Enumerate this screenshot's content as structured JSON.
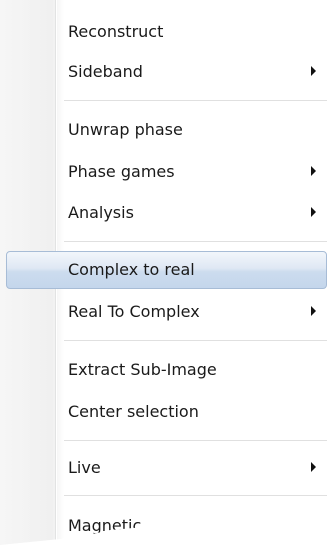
{
  "menu": {
    "items": [
      {
        "label": "Reconstruct",
        "submenu": false
      },
      {
        "label": "Sideband",
        "submenu": true
      },
      {
        "label": "Unwrap phase",
        "submenu": false
      },
      {
        "label": "Phase games",
        "submenu": true
      },
      {
        "label": "Analysis",
        "submenu": true
      },
      {
        "label": "Complex to real",
        "submenu": false,
        "highlighted": true
      },
      {
        "label": "Real To Complex",
        "submenu": true
      },
      {
        "label": "Extract Sub-Image",
        "submenu": false
      },
      {
        "label": "Center selection",
        "submenu": false
      },
      {
        "label": "Live",
        "submenu": true
      },
      {
        "label": "Magnetic",
        "submenu": false
      }
    ]
  },
  "colors": {
    "highlight_top": "#f2f6fb",
    "highlight_bottom": "#c4d6ec",
    "highlight_border": "#a7bcd6",
    "text": "#1a1a1a"
  }
}
